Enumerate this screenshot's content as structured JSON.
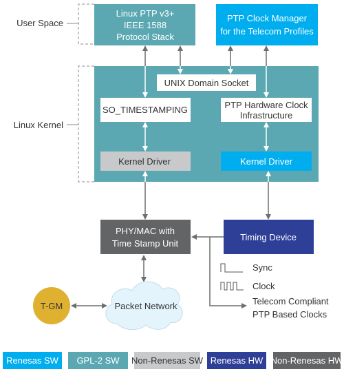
{
  "colors": {
    "renesas_sw": "#00aeef",
    "gpl2_sw": "#5ba8b2",
    "non_renesas_sw": "#c8c9cb",
    "renesas_hw": "#2e3f97",
    "non_renesas_hw": "#636466",
    "tgm": "#e0b030",
    "cloud": "#e3f4fc",
    "arrow": "#6d6e70"
  },
  "layers": {
    "user_space": "User Space",
    "linux_kernel": "Linux Kernel"
  },
  "blocks": {
    "linuxptp": [
      "Linux PTP v3+",
      "IEEE 1588",
      "Protocol Stack"
    ],
    "clock_manager": [
      "PTP Clock Manager",
      "for the Telecom Profiles"
    ],
    "unix_socket": "UNIX Domain Socket",
    "so_timestamping": "SO_TIMESTAMPING",
    "phc": [
      "PTP Hardware Clock",
      "Infrastructure"
    ],
    "kernel_driver_left": "Kernel Driver",
    "kernel_driver_right": "Kernel Driver",
    "phy_mac": [
      "PHY/MAC with",
      "Time Stamp Unit"
    ],
    "timing_device": "Timing Device",
    "packet_network": "Packet Network",
    "tgm": "T-GM"
  },
  "outputs": {
    "sync": "Sync",
    "clock": "Clock",
    "telecom": [
      "Telecom Compliant",
      "PTP Based Clocks"
    ]
  },
  "legend": [
    {
      "label": "Renesas SW",
      "color": "#00aeef",
      "text": "#ffffff"
    },
    {
      "label": "GPL-2 SW",
      "color": "#5ba8b2",
      "text": "#ffffff"
    },
    {
      "label": "Non-Renesas SW",
      "color": "#c8c9cb",
      "text": "#333333"
    },
    {
      "label": "Renesas HW",
      "color": "#2e3f97",
      "text": "#ffffff"
    },
    {
      "label": "Non-Renesas HW",
      "color": "#636466",
      "text": "#ffffff"
    }
  ]
}
